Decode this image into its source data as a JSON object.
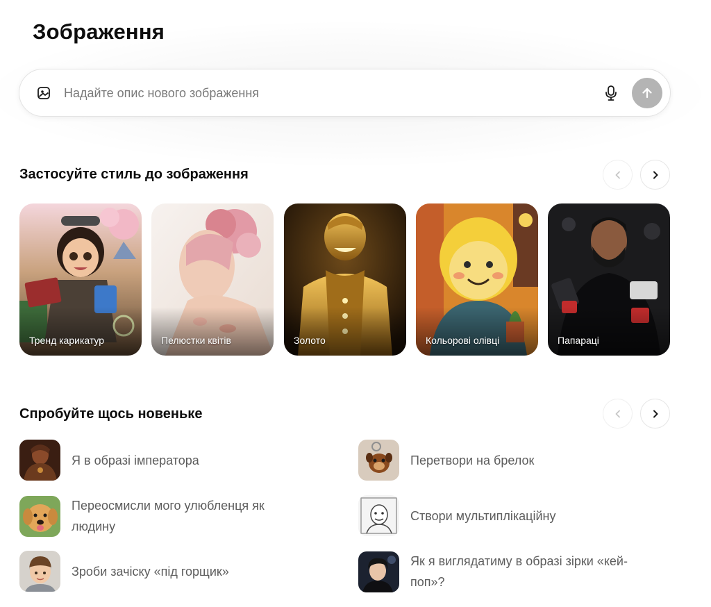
{
  "page": {
    "title": "Зображення"
  },
  "prompt": {
    "placeholder": "Надайте опис нового зображення",
    "value": "",
    "icons": {
      "left": "image-add-icon",
      "mic": "microphone-icon",
      "send": "arrow-up-icon"
    }
  },
  "styles_section": {
    "title": "Застосуйте стиль до зображення",
    "prev_icon": "chevron-left-icon",
    "next_icon": "chevron-right-icon",
    "cards": [
      {
        "label": "Тренд карикатур"
      },
      {
        "label": "Пелюстки квітів"
      },
      {
        "label": "Золото"
      },
      {
        "label": "Кольорові олівці"
      },
      {
        "label": "Папараці"
      }
    ]
  },
  "try_section": {
    "title": "Спробуйте щось новеньке",
    "prev_icon": "chevron-left-icon",
    "next_icon": "chevron-right-icon",
    "items": [
      {
        "label": "Я в образі імператора"
      },
      {
        "label": "Перетвори на брелок"
      },
      {
        "label": "Переосмисли мого улюбленця як людину"
      },
      {
        "label": "Створи мультиплікаційну"
      },
      {
        "label": "Зроби зачіску «під горщик»"
      },
      {
        "label": "Як я виглядатиму в образі зірки «кей-поп»?"
      }
    ]
  },
  "colors": {
    "send_button": "#b4b4b4",
    "text_primary": "#0d0d0d",
    "text_secondary": "#5d5d5d",
    "placeholder": "#7a7a7a"
  }
}
